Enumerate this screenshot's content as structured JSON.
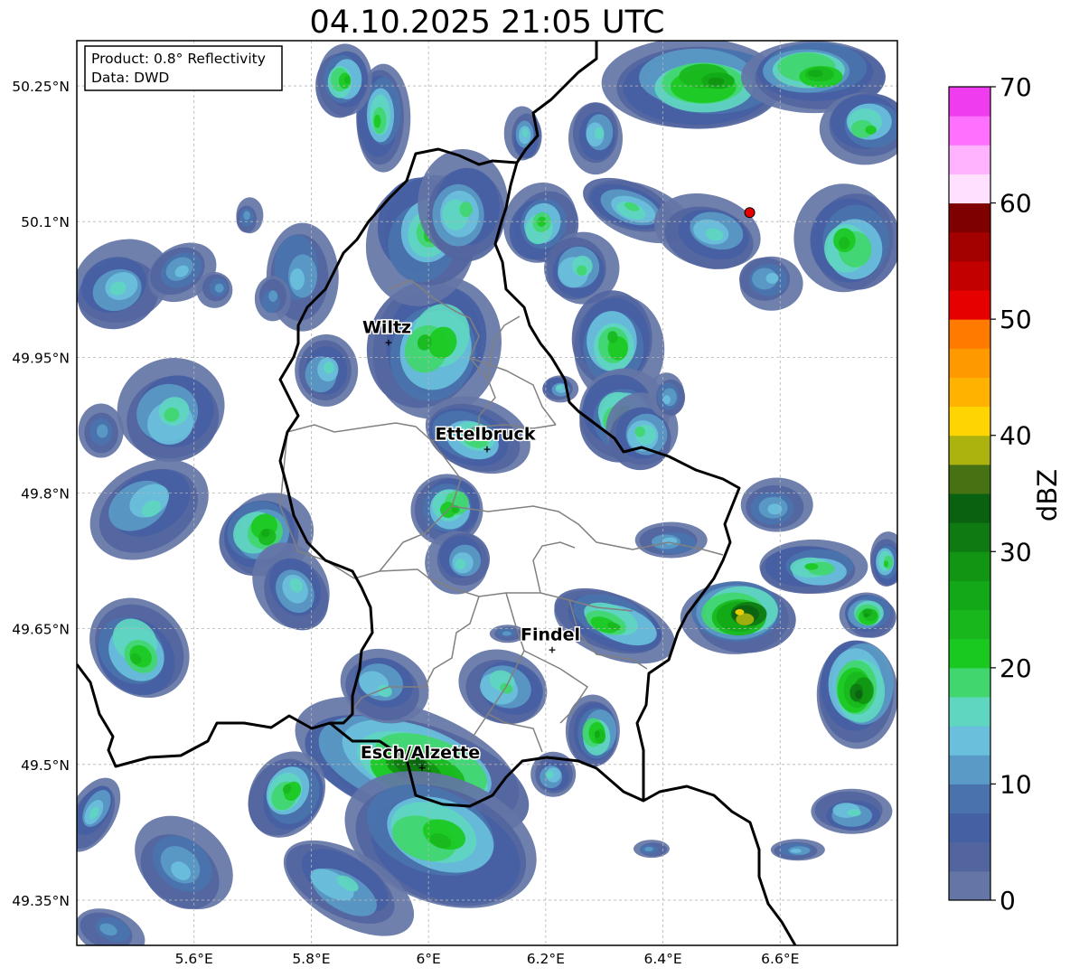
{
  "title": "04.10.2025 21:05 UTC",
  "info_box": {
    "product": "Product: 0.8° Reflectivity",
    "data": "Data: DWD"
  },
  "map": {
    "lon_range": [
      5.4,
      6.8
    ],
    "lat_range": [
      49.3,
      50.3
    ],
    "lon_ticks": [
      {
        "value": 5.6,
        "label": "5.6°E"
      },
      {
        "value": 5.8,
        "label": "5.8°E"
      },
      {
        "value": 6.0,
        "label": "6°E"
      },
      {
        "value": 6.2,
        "label": "6.2°E"
      },
      {
        "value": 6.4,
        "label": "6.4°E"
      },
      {
        "value": 6.6,
        "label": "6.6°E"
      }
    ],
    "lat_ticks": [
      {
        "value": 50.25,
        "label": "50.25°N"
      },
      {
        "value": 50.1,
        "label": "50.1°N"
      },
      {
        "value": 49.95,
        "label": "49.95°N"
      },
      {
        "value": 49.8,
        "label": "49.8°N"
      },
      {
        "value": 49.65,
        "label": "49.65°N"
      },
      {
        "value": 49.5,
        "label": "49.5°N"
      },
      {
        "value": 49.35,
        "label": "49.35°N"
      }
    ],
    "cities": [
      {
        "name": "Wiltz",
        "lon": 5.932,
        "lat": 49.967
      },
      {
        "name": "Ettelbruck",
        "lon": 6.1,
        "lat": 49.849
      },
      {
        "name": "Findel",
        "lon": 6.211,
        "lat": 49.627
      },
      {
        "name": "Esch/Alzette",
        "lon": 5.989,
        "lat": 49.497
      }
    ],
    "radar_site": {
      "lon": 6.548,
      "lat": 50.11,
      "color": "#e60000"
    }
  },
  "colorbar": {
    "label": "dBZ",
    "range": [
      0,
      70
    ],
    "tick_values": [
      0,
      10,
      20,
      30,
      40,
      50,
      60,
      70
    ],
    "colors": [
      "#6475a6",
      "#52659e",
      "#4560a3",
      "#4a73ad",
      "#5a9ac6",
      "#6abfdc",
      "#5fd6c0",
      "#41d66e",
      "#1ac91f",
      "#18b81c",
      "#12a817",
      "#119512",
      "#0f7a12",
      "#0a6210",
      "#477213",
      "#adb30e",
      "#fed500",
      "#ffb200",
      "#ff9900",
      "#ff7b00",
      "#e60000",
      "#c30000",
      "#a30000",
      "#7f0000",
      "#ffe0ff",
      "#ffb3ff",
      "#ff70ff",
      "#ee3cee"
    ]
  },
  "colors": {
    "border": "#000000",
    "cantons": "#808080",
    "grid": "#b4b4b4"
  }
}
